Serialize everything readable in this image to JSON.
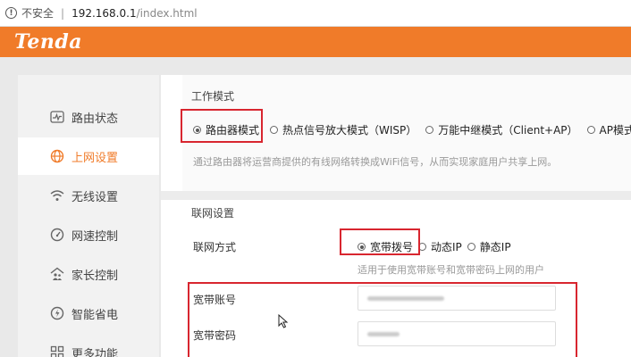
{
  "browser": {
    "security_label": "不安全",
    "separator": "|",
    "url_host": "192.168.0.1",
    "url_path": "/index.html"
  },
  "brand": {
    "logo_text": "Tenda"
  },
  "sidebar": {
    "items": [
      {
        "label": "路由状态",
        "icon": "status-icon",
        "active": false
      },
      {
        "label": "上网设置",
        "icon": "globe-icon",
        "active": true
      },
      {
        "label": "无线设置",
        "icon": "wifi-icon",
        "active": false
      },
      {
        "label": "网速控制",
        "icon": "speed-gauge-icon",
        "active": false
      },
      {
        "label": "家长控制",
        "icon": "family-icon",
        "active": false
      },
      {
        "label": "智能省电",
        "icon": "power-save-icon",
        "active": false
      },
      {
        "label": "更多功能",
        "icon": "grid-icon",
        "active": false
      }
    ]
  },
  "work_mode": {
    "title": "工作模式",
    "options": [
      "路由器模式",
      "热点信号放大模式（WISP）",
      "万能中继模式（Client+AP）",
      "AP模式"
    ],
    "selected": "路由器模式",
    "hint": "通过路由器将运营商提供的有线网络转换成WiFi信号，从而实现家庭用户共享上网。"
  },
  "internet": {
    "title": "联网设置",
    "method_label": "联网方式",
    "options": [
      "宽带拨号",
      "动态IP",
      "静态IP"
    ],
    "selected": "宽带拨号",
    "hint": "适用于使用宽带账号和宽带密码上网的用户",
    "account_label": "宽带账号",
    "password_label": "宽带密码"
  },
  "colors": {
    "accent": "#f07b29",
    "highlight_box": "#d8262f"
  }
}
